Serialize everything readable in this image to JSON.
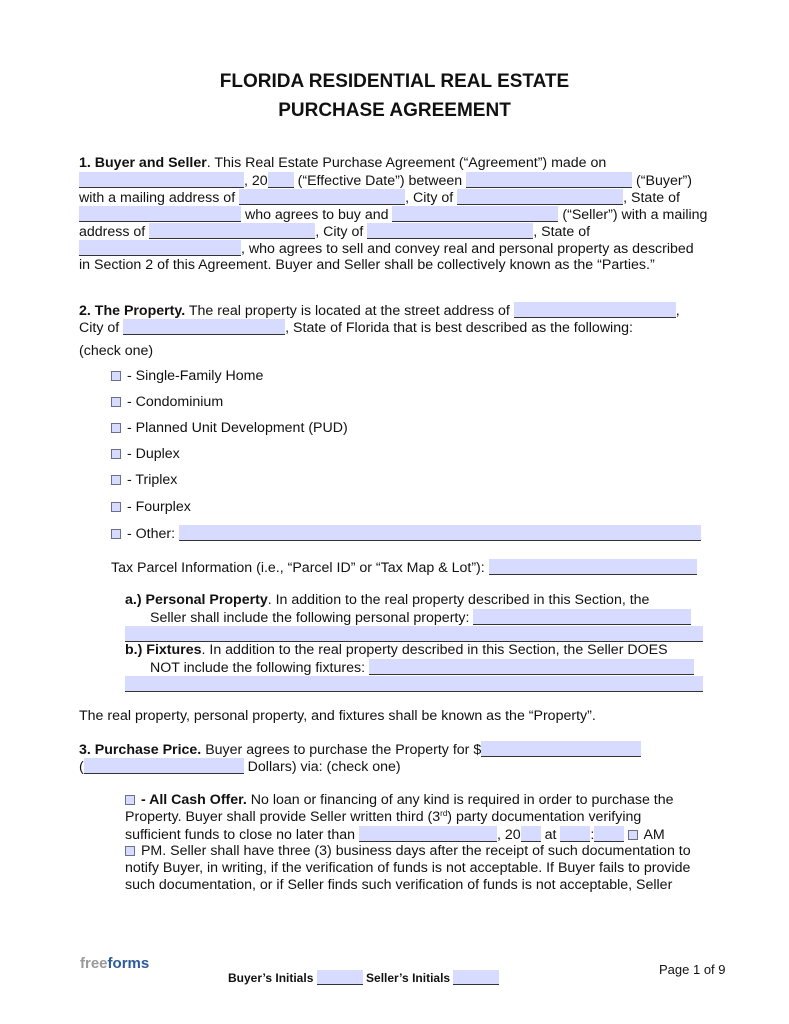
{
  "document": {
    "title_line1": "FLORIDA RESIDENTIAL REAL ESTATE",
    "title_line2": "PURCHASE AGREEMENT"
  },
  "section1": {
    "heading": "1. Buyer and Seller",
    "l1_text": ". This Real Estate Purchase Agreement (“Agreement”) made on",
    "l2_a": ", 20",
    "l2_b": " (“Effective Date”) between ",
    "l2_c": " (“Buyer”)",
    "l3_a": "with a mailing address of ",
    "l3_b": ", City of ",
    "l3_c": ", State of",
    "l4_a": " who agrees to buy and ",
    "l4_b": " (“Seller”) with a mailing",
    "l5_a": "address of ",
    "l5_b": ", City of ",
    "l5_c": ", State of",
    "l6_a": ", who agrees to sell and convey real and personal property as described",
    "l7": "in Section 2 of this Agreement. Buyer and Seller shall be collectively known as the “Parties.”",
    "fields": {
      "effective_date": "",
      "effective_year": "",
      "buyer_name": "",
      "buyer_address": "",
      "buyer_city": "",
      "buyer_state": "",
      "seller_name": "",
      "seller_address": "",
      "seller_city": "",
      "seller_state": ""
    }
  },
  "section2": {
    "heading": "2. The Property.",
    "l1_text": " The real property is located at the street address of ",
    "l1_end": ",",
    "l2_a": "City of ",
    "l2_b": ", State of Florida that is best described as the following:",
    "check_one": "(check one)",
    "property_types": [
      {
        "label": " - Single-Family Home",
        "checked": false
      },
      {
        "label": " - Condominium",
        "checked": false
      },
      {
        "label": " - Planned Unit Development (PUD)",
        "checked": false
      },
      {
        "label": " - Duplex",
        "checked": false
      },
      {
        "label": " - Triplex",
        "checked": false
      },
      {
        "label": " - Fourplex",
        "checked": false
      },
      {
        "label": " - Other: ",
        "checked": false
      }
    ],
    "tax_parcel_label": "Tax Parcel Information (i.e., “Parcel ID” or “Tax Map & Lot”): ",
    "a_label": "a.)",
    "a_heading": "Personal Property",
    "a_text1": ". In addition to the real property described in this Section, the",
    "a_text2": "Seller shall include the following personal property: ",
    "b_label": "b.)",
    "b_heading": "Fixtures",
    "b_text1": ". In addition to the real property described in this Section, the Seller DOES",
    "b_text2": "NOT include the following fixtures: ",
    "closing": "The real property, personal property, and fixtures shall be known as the “Property”.",
    "fields": {
      "street_address": "",
      "city": "",
      "other": "",
      "tax_parcel": "",
      "personal_property": "",
      "fixtures": ""
    }
  },
  "section3": {
    "heading": "3. Purchase Price.",
    "l1_text": " Buyer agrees to purchase the Property for $",
    "l2_a": "(",
    "l2_b": " Dollars) via: (check one)",
    "cash_heading": " - All Cash Offer.",
    "cash_l1": " No loan or financing of any kind is required in order to purchase the",
    "cash_l2a": "Property. Buyer shall provide Seller written third (3",
    "cash_l2sup": "rd",
    "cash_l2b": ") party documentation verifying",
    "cash_l3a": "sufficient funds to close no later than ",
    "cash_l3b": ", 20",
    "cash_l3c": " at ",
    "cash_l3d": ":",
    "am_label": " AM",
    "pm_label": " PM.",
    "cash_l4": " Seller shall have three (3) business days after the receipt of such documentation to",
    "cash_l5": "notify Buyer, in writing, if the verification of funds is not acceptable. If Buyer fails to provide",
    "cash_l6": "such documentation, or if Seller finds such verification of funds is not acceptable, Seller",
    "fields": {
      "price_amount": "",
      "price_words": "",
      "funds_date": "",
      "funds_year": "",
      "funds_hour": "",
      "funds_minute": "",
      "am_checked": false,
      "pm_checked": false,
      "cash_checked": false
    }
  },
  "footer": {
    "logo_free": "free",
    "logo_forms": "forms",
    "buyer_initials_label": "Buyer’s Initials ",
    "seller_initials_label": " Seller’s Initials ",
    "page_label": "Page 1 of 9"
  },
  "colors": {
    "field_fill": "#d6dbff",
    "logo_gray": "#9a9a9a",
    "logo_blue": "#2b5c9a"
  }
}
